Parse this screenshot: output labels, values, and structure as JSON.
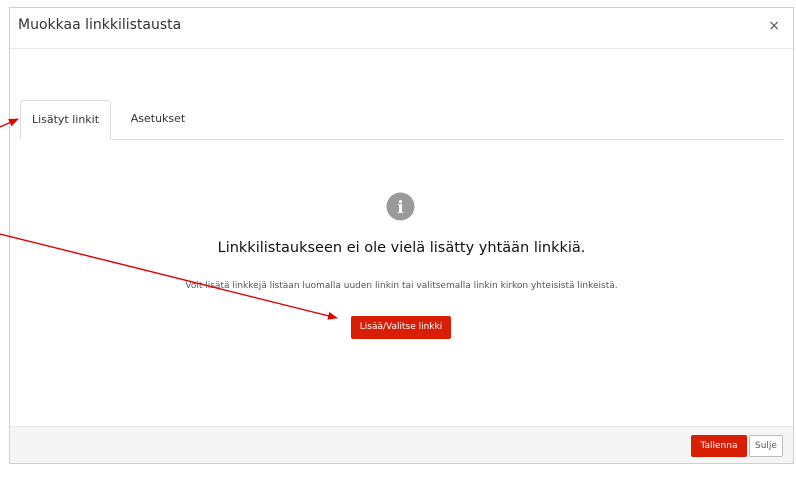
{
  "dialog": {
    "title": "Muokkaa linkkilistausta",
    "close_symbol": "×"
  },
  "tabs": [
    {
      "label": "Lisätyt linkit",
      "active": true
    },
    {
      "label": "Asetukset",
      "active": false
    }
  ],
  "empty_state": {
    "icon": "info-icon",
    "icon_glyph": "i",
    "heading": "Linkkilistaukseen ei ole vielä lisätty yhtään linkkiä.",
    "description": "Voit lisätä linkkejä listaan luomalla uuden linkin tai valitsemalla linkin kirkon yhteisistä linkeistä.",
    "add_button_label": "Lisää/Valitse linkki"
  },
  "footer": {
    "save_label": "Tallenna",
    "close_label": "Sulje"
  },
  "colors": {
    "accent": "#d81e05",
    "annotation_arrow": "#e00000",
    "icon_gray": "#9a9a9a"
  }
}
